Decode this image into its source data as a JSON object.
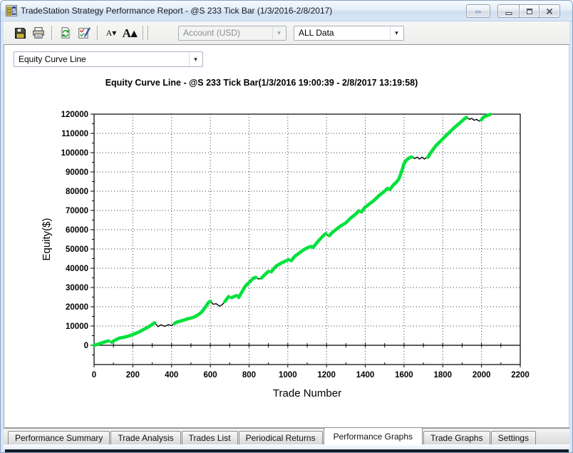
{
  "window": {
    "title": "TradeStation Strategy Performance Report - @S 233 Tick Bar (1/3/2016-2/8/2017)"
  },
  "toolbar": {
    "account_combo": {
      "value": "Account (USD)",
      "disabled": true,
      "arrow": "▾"
    },
    "data_combo": {
      "value": "ALL Data",
      "arrow": "▾"
    },
    "font_decrease_label": "A▾",
    "font_increase_label": "A▴",
    "dock_glyph": "⇔"
  },
  "graph_selector": {
    "value": "Equity Curve Line",
    "arrow": "▾"
  },
  "tabs": [
    {
      "label": "Performance Summary",
      "active": false
    },
    {
      "label": "Trade Analysis",
      "active": false
    },
    {
      "label": "Trades List",
      "active": false
    },
    {
      "label": "Periodical Returns",
      "active": false
    },
    {
      "label": "Performance Graphs",
      "active": true
    },
    {
      "label": "Trade Graphs",
      "active": false
    },
    {
      "label": "Settings",
      "active": false
    }
  ],
  "chart_data": {
    "type": "line",
    "title": "Equity Curve Line - @S 233 Tick Bar(1/3/2016 19:00:39 - 2/8/2017 13:19:58)",
    "xlabel": "Trade Number",
    "ylabel": "Equity($)",
    "xlim": [
      0,
      2200
    ],
    "ylim": [
      -10000,
      120000
    ],
    "x_ticks": [
      0,
      200,
      400,
      600,
      800,
      1000,
      1200,
      1400,
      1600,
      1800,
      2000,
      2200
    ],
    "y_ticks": [
      0,
      10000,
      20000,
      30000,
      40000,
      50000,
      60000,
      70000,
      80000,
      90000,
      100000,
      110000,
      120000
    ],
    "grid": "dotted-major",
    "legend": "none",
    "colors": {
      "new_high": "#00E13C",
      "drawdown": "#000000"
    },
    "series": [
      {
        "name": "Equity",
        "points": [
          [
            0,
            0
          ],
          [
            15,
            400
          ],
          [
            30,
            900
          ],
          [
            45,
            1400
          ],
          [
            60,
            1900
          ],
          [
            75,
            2300
          ],
          [
            90,
            1600
          ],
          [
            105,
            2500
          ],
          [
            130,
            3700
          ],
          [
            160,
            4300
          ],
          [
            185,
            5000
          ],
          [
            215,
            6200
          ],
          [
            240,
            7300
          ],
          [
            265,
            8700
          ],
          [
            290,
            10100
          ],
          [
            313,
            11700
          ],
          [
            330,
            9700
          ],
          [
            345,
            10600
          ],
          [
            365,
            9900
          ],
          [
            385,
            10700
          ],
          [
            400,
            10200
          ],
          [
            415,
            11300
          ],
          [
            430,
            12200
          ],
          [
            455,
            12800
          ],
          [
            470,
            13300
          ],
          [
            485,
            13800
          ],
          [
            500,
            14100
          ],
          [
            515,
            14600
          ],
          [
            535,
            15700
          ],
          [
            552,
            16900
          ],
          [
            570,
            19100
          ],
          [
            589,
            22000
          ],
          [
            600,
            22900
          ],
          [
            615,
            21300
          ],
          [
            630,
            21600
          ],
          [
            648,
            20300
          ],
          [
            662,
            21100
          ],
          [
            675,
            22700
          ],
          [
            695,
            25300
          ],
          [
            710,
            24700
          ],
          [
            725,
            25400
          ],
          [
            736,
            25800
          ],
          [
            747,
            24800
          ],
          [
            765,
            28000
          ],
          [
            780,
            30600
          ],
          [
            795,
            32100
          ],
          [
            809,
            33400
          ],
          [
            820,
            34700
          ],
          [
            835,
            35300
          ],
          [
            850,
            34400
          ],
          [
            864,
            34900
          ],
          [
            880,
            36600
          ],
          [
            901,
            38400
          ],
          [
            915,
            38100
          ],
          [
            930,
            40100
          ],
          [
            944,
            41400
          ],
          [
            960,
            42300
          ],
          [
            975,
            43100
          ],
          [
            1005,
            44500
          ],
          [
            1018,
            43900
          ],
          [
            1035,
            46100
          ],
          [
            1055,
            47600
          ],
          [
            1075,
            49100
          ],
          [
            1091,
            50100
          ],
          [
            1110,
            51000
          ],
          [
            1122,
            51300
          ],
          [
            1131,
            50800
          ],
          [
            1145,
            52600
          ],
          [
            1159,
            54300
          ],
          [
            1183,
            56900
          ],
          [
            1196,
            58000
          ],
          [
            1205,
            57100
          ],
          [
            1214,
            56900
          ],
          [
            1226,
            58200
          ],
          [
            1245,
            59800
          ],
          [
            1269,
            61700
          ],
          [
            1285,
            62700
          ],
          [
            1300,
            63600
          ],
          [
            1325,
            66100
          ],
          [
            1349,
            68000
          ],
          [
            1368,
            69800
          ],
          [
            1380,
            69200
          ],
          [
            1398,
            71600
          ],
          [
            1423,
            73500
          ],
          [
            1447,
            75400
          ],
          [
            1472,
            77800
          ],
          [
            1496,
            79700
          ],
          [
            1515,
            81500
          ],
          [
            1527,
            80900
          ],
          [
            1545,
            83300
          ],
          [
            1560,
            84600
          ],
          [
            1572,
            86100
          ],
          [
            1582,
            88600
          ],
          [
            1592,
            91600
          ],
          [
            1600,
            94400
          ],
          [
            1612,
            96100
          ],
          [
            1625,
            97200
          ],
          [
            1640,
            97800
          ],
          [
            1655,
            97000
          ],
          [
            1668,
            97700
          ],
          [
            1680,
            96700
          ],
          [
            1693,
            97700
          ],
          [
            1705,
            96700
          ],
          [
            1715,
            97400
          ],
          [
            1723,
            97600
          ],
          [
            1742,
            100600
          ],
          [
            1766,
            103800
          ],
          [
            1791,
            106200
          ],
          [
            1815,
            108700
          ],
          [
            1840,
            111100
          ],
          [
            1864,
            113400
          ],
          [
            1889,
            115500
          ],
          [
            1911,
            117500
          ],
          [
            1923,
            118300
          ],
          [
            1938,
            117300
          ],
          [
            1950,
            117800
          ],
          [
            1962,
            116800
          ],
          [
            1975,
            117300
          ],
          [
            1987,
            116400
          ],
          [
            1999,
            117000
          ],
          [
            2010,
            118400
          ],
          [
            2030,
            119400
          ],
          [
            2045,
            119800
          ]
        ]
      }
    ]
  }
}
